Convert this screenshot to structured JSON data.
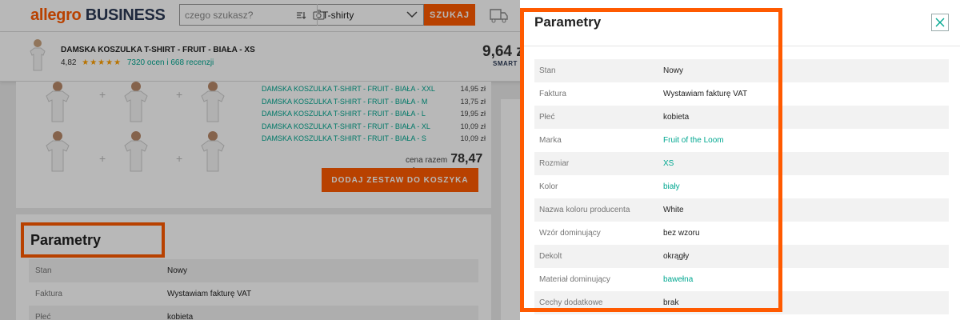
{
  "header": {
    "logo_allegro": "allegro",
    "logo_business": "BUSINESS",
    "search_placeholder": "czego szukasz?",
    "category": "T-shirty",
    "search_button": "SZUKAJ"
  },
  "product_bar": {
    "title": "DAMSKA KOSZULKA T-SHIRT - FRUIT - BIAŁA - XS",
    "rating_value": "4,82",
    "stars": "★★★★★",
    "reviews": "7320 ocen i 668 recenzji",
    "price": "9,64 z",
    "smart": "SMART"
  },
  "bundle": {
    "items": [
      {
        "name": "DAMSKA KOSZULKA T-SHIRT - FRUIT - BIAŁA - XXL",
        "price": "14,95 zł"
      },
      {
        "name": "DAMSKA KOSZULKA T-SHIRT - FRUIT - BIAŁA - M",
        "price": "13,75 zł"
      },
      {
        "name": "DAMSKA KOSZULKA T-SHIRT - FRUIT - BIAŁA - L",
        "price": "19,95 zł"
      },
      {
        "name": "DAMSKA KOSZULKA T-SHIRT - FRUIT - BIAŁA - XL",
        "price": "10,09 zł"
      },
      {
        "name": "DAMSKA KOSZULKA T-SHIRT - FRUIT - BIAŁA - S",
        "price": "10,09 zł"
      }
    ],
    "total_label": "cena razem",
    "total_value": "78,47 zł",
    "add_button": "DODAJ ZESTAW DO KOSZYKA",
    "plus": "+"
  },
  "background_params": {
    "title": "Parametry",
    "rows": [
      {
        "key": "Stan",
        "value": "Nowy"
      },
      {
        "key": "Faktura",
        "value": "Wystawiam fakturę VAT"
      },
      {
        "key": "Płeć",
        "value": "kobieta"
      }
    ]
  },
  "panel": {
    "title": "Parametry",
    "rows": [
      {
        "key": "Stan",
        "value": "Nowy"
      },
      {
        "key": "Faktura",
        "value": "Wystawiam fakturę VAT"
      },
      {
        "key": "Płeć",
        "value": "kobieta"
      },
      {
        "key": "Marka",
        "value": "Fruit of the Loom"
      },
      {
        "key": "Rozmiar",
        "value": "XS"
      },
      {
        "key": "Kolor",
        "value": "biały"
      },
      {
        "key": "Nazwa koloru producenta",
        "value": "White"
      },
      {
        "key": "Wzór dominujący",
        "value": "bez wzoru"
      },
      {
        "key": "Dekolt",
        "value": "okrągły"
      },
      {
        "key": "Materiał dominujący",
        "value": "bawełna"
      },
      {
        "key": "Cechy dodatkowe",
        "value": "brak"
      }
    ]
  },
  "colors": {
    "brand_orange": "#ff5a00",
    "link_green": "#00a790",
    "highlight": "#ff5a00"
  },
  "icons": [
    "camera-icon",
    "voice-search-icon",
    "chevron-down-icon",
    "truck-icon",
    "close-icon",
    "star-icon"
  ]
}
